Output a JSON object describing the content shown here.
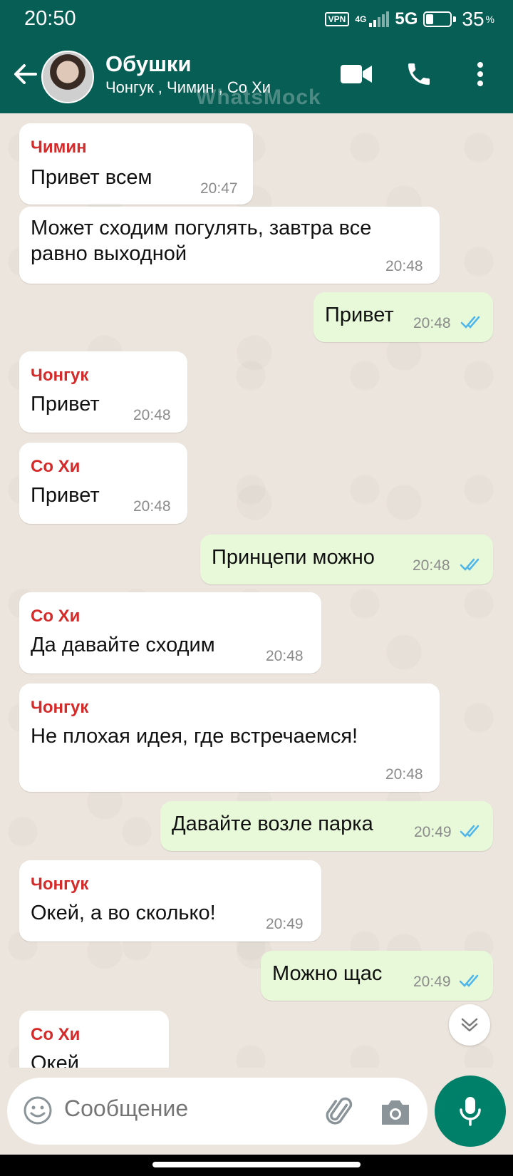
{
  "status_bar": {
    "time": "20:50",
    "vpn": "VPN",
    "network_4g": "4G",
    "network": "5G",
    "battery": "35",
    "battery_symbol": "%"
  },
  "header": {
    "title": "Обушки",
    "subtitle": "Чонгук , Чимин , Со Хи",
    "watermark": "WhatsMock"
  },
  "messages": [
    {
      "direction": "in",
      "sender": "Чимин",
      "text": "Привет всем",
      "time": "20:47"
    },
    {
      "direction": "in",
      "sender": "",
      "text": "Может сходим погулять, завтра все",
      "text2": "равно выходной",
      "time": "20:48"
    },
    {
      "direction": "out",
      "text": "Привет",
      "time": "20:48",
      "status": "read"
    },
    {
      "direction": "in",
      "sender": "Чонгук",
      "text": "Привет",
      "time": "20:48"
    },
    {
      "direction": "in",
      "sender": "Со Хи",
      "text": "Привет",
      "time": "20:48"
    },
    {
      "direction": "out",
      "text": "Принцепи можно",
      "time": "20:48",
      "status": "read"
    },
    {
      "direction": "in",
      "sender": "Со Хи",
      "text": "Да давайте сходим",
      "time": "20:48"
    },
    {
      "direction": "in",
      "sender": "Чонгук",
      "text": "Не плохая идея, где встречаемся!",
      "time": "20:48"
    },
    {
      "direction": "out",
      "text": "Давайте возле парка",
      "time": "20:49",
      "status": "read"
    },
    {
      "direction": "in",
      "sender": "Чонгук",
      "text": "Окей, а во сколько!",
      "time": "20:49"
    },
    {
      "direction": "out",
      "text": "Можно щас",
      "time": "20:49",
      "status": "read"
    },
    {
      "direction": "in",
      "sender": "Со Хи",
      "text": "Окей",
      "time": ""
    }
  ],
  "composer": {
    "placeholder": "Сообщение"
  },
  "colors": {
    "header": "#075e54",
    "sender_name": "#d52a2a",
    "outgoing_bubble": "#e7f9d9",
    "read_ticks": "#4fb6ec",
    "mic_button": "#008069"
  },
  "icons": {
    "back": "arrow-left-icon",
    "video": "video-camera-icon",
    "call": "phone-icon",
    "menu": "more-vertical-icon",
    "emoji": "emoji-icon",
    "attach": "paperclip-icon",
    "camera": "camera-icon",
    "mic": "microphone-icon",
    "scroll": "chevron-double-down-icon"
  }
}
